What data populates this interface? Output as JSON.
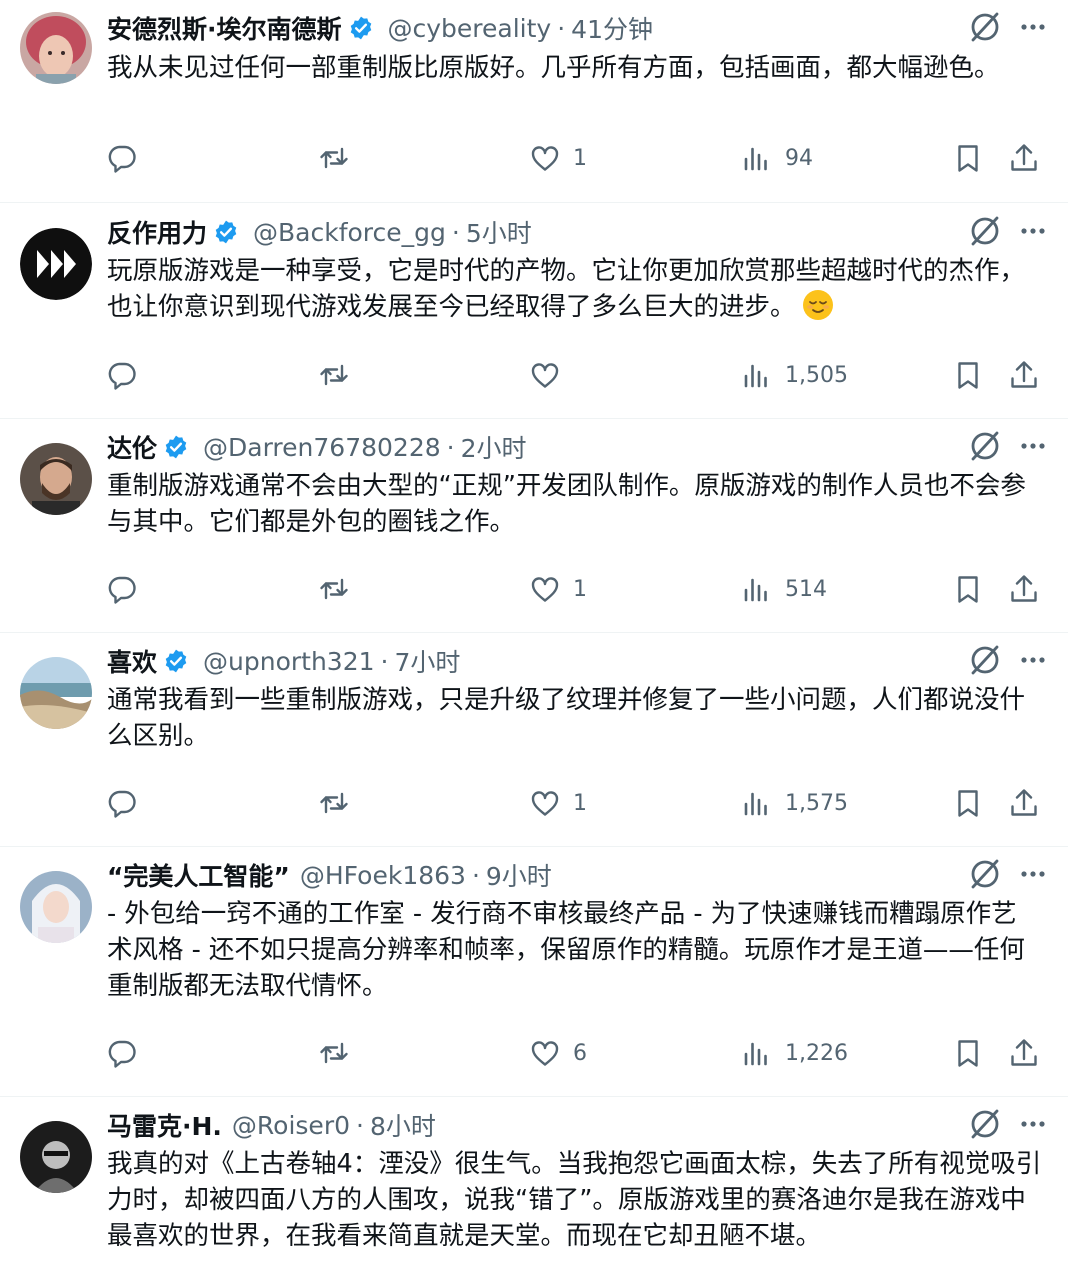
{
  "colors": {
    "text": "#0f1419",
    "secondary": "#536471",
    "verified": "#1d9bf0",
    "divider": "#eff3f4"
  },
  "icons": {
    "reply": "reply-icon",
    "retweet": "retweet-icon",
    "like": "heart-icon",
    "views": "views-icon",
    "bookmark": "bookmark-icon",
    "share": "share-icon",
    "grok": "grok-icon",
    "more": "more-icon",
    "verified": "verified-badge-icon"
  },
  "tweets": [
    {
      "name": "安德烈斯·埃尔南德斯",
      "verified": true,
      "handle": "@cybereality",
      "dot": "·",
      "time": "41分钟",
      "text": "我从未见过任何一部重制版比原版好。几乎所有方面，包括画面，都大幅逊色。",
      "replies": "",
      "retweets": "",
      "likes": "1",
      "views": "94"
    },
    {
      "name": "反作用力",
      "verified": true,
      "handle": "@Backforce_gg",
      "dot": "·",
      "time": "5小时",
      "text": "玩原版游戏是一种享受，它是时代的产物。它让你更加欣赏那些超越时代的杰作，也让你意识到现代游戏发展至今已经取得了多么巨大的进步。",
      "emoji": "relieved-face-emoji",
      "replies": "",
      "retweets": "",
      "likes": "",
      "views": "1,505"
    },
    {
      "name": "达伦",
      "verified": true,
      "handle": "@Darren76780228",
      "dot": "·",
      "time": "2小时",
      "text": "重制版游戏通常不会由大型的“正规”开发团队制作。原版游戏的制作人员也不会参与其中。它们都是外包的圈钱之作。",
      "replies": "",
      "retweets": "",
      "likes": "1",
      "views": "514"
    },
    {
      "name": "喜欢",
      "verified": true,
      "handle": "@upnorth321",
      "dot": "·",
      "time": "7小时",
      "text": "通常我看到一些重制版游戏，只是升级了纹理并修复了一些小问题，人们都说没什么区别。",
      "replies": "",
      "retweets": "",
      "likes": "1",
      "views": "1,575"
    },
    {
      "name": "“完美人工智能”",
      "verified": false,
      "handle": "@HFoek1863",
      "dot": "·",
      "time": "9小时",
      "text": "- 外包给一窍不通的工作室 - 发行商不审核最终产品 - 为了快速赚钱而糟蹋原作艺术风格 - 还不如只提高分辨率和帧率，保留原作的精髓。玩原作才是王道——任何重制版都无法取代情怀。",
      "replies": "",
      "retweets": "",
      "likes": "6",
      "views": "1,226"
    },
    {
      "name": "马雷克·H.",
      "verified": false,
      "handle": "@Roiser0",
      "dot": "·",
      "time": "8小时",
      "text": "我真的对《上古卷轴4：湮没》很生气。当我抱怨它画面太棕，失去了所有视觉吸引力时，却被四面八方的人围攻，说我“错了”。原版游戏里的赛洛迪尔是我在游戏中最喜欢的世界，在我看来简直就是天堂。而现在它却丑陋不堪。",
      "replies": "",
      "retweets": "",
      "likes": "",
      "views": ""
    }
  ]
}
